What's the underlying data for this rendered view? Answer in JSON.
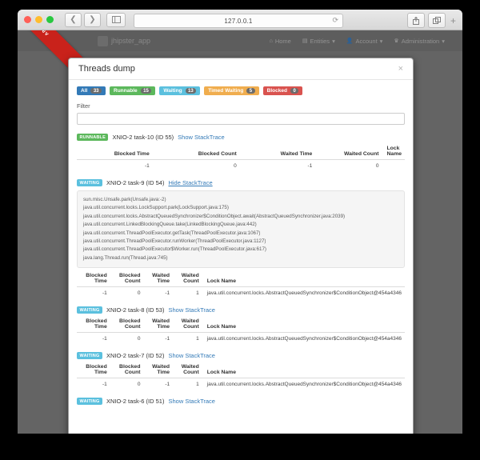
{
  "browser": {
    "url": "127.0.0.1",
    "back_icon": "chevron-left-icon",
    "forward_icon": "chevron-right-icon",
    "sidebar_icon": "sidebar-icon",
    "reload_icon": "reload-icon",
    "share_icon": "share-icon",
    "tabs_icon": "tabs-icon",
    "new_tab_label": "+"
  },
  "app": {
    "brand": "jhipster_app",
    "brand_sub": "",
    "ribbon": "dev",
    "nav": [
      {
        "label": "Home",
        "icon": "home-icon",
        "caret": ""
      },
      {
        "label": "Entities",
        "icon": "list-icon",
        "caret": "▾"
      },
      {
        "label": "Account",
        "icon": "user-icon",
        "caret": "▾"
      },
      {
        "label": "Administration",
        "icon": "crown-icon",
        "caret": "▾"
      }
    ]
  },
  "modal": {
    "title": "Threads dump",
    "close_icon": "close-icon",
    "badges": [
      {
        "label": "All",
        "count": "33",
        "style": "b-all"
      },
      {
        "label": "Runnable",
        "count": "15",
        "style": "b-runnable"
      },
      {
        "label": "Waiting",
        "count": "13",
        "style": "b-waiting"
      },
      {
        "label": "Timed Waiting",
        "count": "5",
        "style": "b-timed"
      },
      {
        "label": "Blocked",
        "count": "0",
        "style": "b-blocked"
      }
    ],
    "filter": {
      "label": "Filter",
      "value": "",
      "placeholder": ""
    },
    "columns_wide": [
      "Blocked Time",
      "Blocked Count",
      "Waited Time",
      "Waited Count",
      "Lock Name"
    ],
    "columns_narrow": [
      {
        "l1": "Blocked",
        "l2": "Time"
      },
      {
        "l1": "Blocked",
        "l2": "Count"
      },
      {
        "l1": "Waited",
        "l2": "Time"
      },
      {
        "l1": "Waited",
        "l2": "Count"
      },
      {
        "l1": "Lock Name",
        "l2": ""
      }
    ],
    "threads": [
      {
        "state": "RUNNABLE",
        "state_style": "t-runnable",
        "name": "XNIO-2 task-10 (ID 55)",
        "link": "Show StackTrace",
        "expanded": false,
        "blocked_time": "-1",
        "blocked_count": "0",
        "waited_time": "-1",
        "waited_count": "0",
        "lock_name": "",
        "stack": []
      },
      {
        "state": "WAITING",
        "state_style": "t-waiting",
        "name": "XNIO-2 task-9 (ID 54)",
        "link": "Hide StackTrace",
        "expanded": true,
        "blocked_time": "-1",
        "blocked_count": "0",
        "waited_time": "-1",
        "waited_count": "1",
        "lock_name": "java.util.concurrent.locks.AbstractQueuedSynchronizer$ConditionObject@454a4346",
        "stack": [
          "sun.misc.Unsafe.park(Unsafe.java:-2)",
          "java.util.concurrent.locks.LockSupport.park(LockSupport.java:175)",
          "java.util.concurrent.locks.AbstractQueuedSynchronizer$ConditionObject.await(AbstractQueuedSynchronizer.java:2039)",
          "java.util.concurrent.LinkedBlockingQueue.take(LinkedBlockingQueue.java:442)",
          "java.util.concurrent.ThreadPoolExecutor.getTask(ThreadPoolExecutor.java:1067)",
          "java.util.concurrent.ThreadPoolExecutor.runWorker(ThreadPoolExecutor.java:1127)",
          "java.util.concurrent.ThreadPoolExecutor$Worker.run(ThreadPoolExecutor.java:617)",
          "java.lang.Thread.run(Thread.java:745)"
        ]
      },
      {
        "state": "WAITING",
        "state_style": "t-waiting",
        "name": "XNIO-2 task-8 (ID 53)",
        "link": "Show StackTrace",
        "expanded": false,
        "blocked_time": "-1",
        "blocked_count": "0",
        "waited_time": "-1",
        "waited_count": "1",
        "lock_name": "java.util.concurrent.locks.AbstractQueuedSynchronizer$ConditionObject@454a4346",
        "stack": []
      },
      {
        "state": "WAITING",
        "state_style": "t-waiting",
        "name": "XNIO-2 task-7 (ID 52)",
        "link": "Show StackTrace",
        "expanded": false,
        "blocked_time": "-1",
        "blocked_count": "0",
        "waited_time": "-1",
        "waited_count": "1",
        "lock_name": "java.util.concurrent.locks.AbstractQueuedSynchronizer$ConditionObject@454a4346",
        "stack": []
      },
      {
        "state": "WAITING",
        "state_style": "t-waiting",
        "name": "XNIO-2 task-6 (ID 51)",
        "link": "Show StackTrace",
        "expanded": false,
        "blocked_time": "",
        "blocked_count": "",
        "waited_time": "",
        "waited_count": "",
        "lock_name": "",
        "stack": []
      }
    ]
  }
}
